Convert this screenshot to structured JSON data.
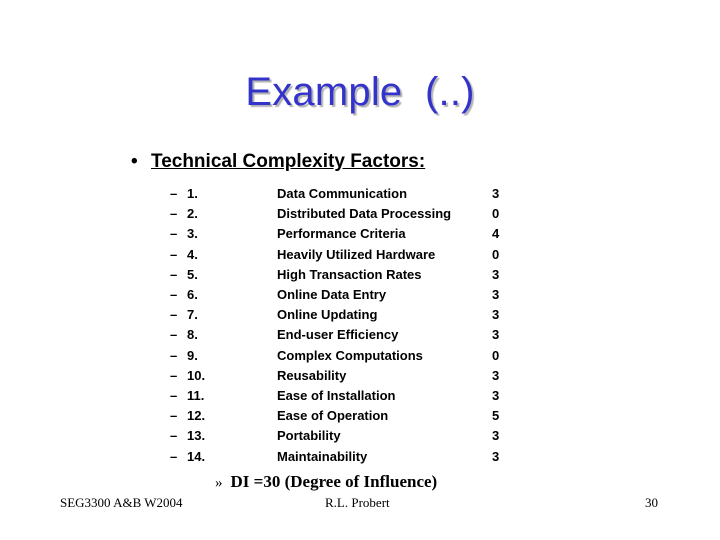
{
  "slide": {
    "title": "Example  (..)",
    "bullet": "•",
    "heading": "Technical Complexity Factors:",
    "sub_bullet": "–",
    "factors": [
      {
        "number": "1.",
        "name": "Data Communication",
        "value": "3"
      },
      {
        "number": "2.",
        "name": "Distributed Data Processing",
        "value": "0"
      },
      {
        "number": "3.",
        "name": "Performance Criteria",
        "value": "4"
      },
      {
        "number": "4.",
        "name": "Heavily Utilized Hardware",
        "value": "0"
      },
      {
        "number": "5.",
        "name": "High Transaction Rates",
        "value": "3"
      },
      {
        "number": "6.",
        "name": "Online Data Entry",
        "value": "3"
      },
      {
        "number": "7.",
        "name": "Online Updating",
        "value": "3"
      },
      {
        "number": "8.",
        "name": "End-user Efficiency",
        "value": "3"
      },
      {
        "number": "9.",
        "name": "Complex Computations",
        "value": "0"
      },
      {
        "number": "10.",
        "name": "Reusability",
        "value": "3"
      },
      {
        "number": "11.",
        "name": "Ease of Installation",
        "value": "3"
      },
      {
        "number": "12.",
        "name": "Ease of Operation",
        "value": "5"
      },
      {
        "number": "13.",
        "name": "Portability",
        "value": "3"
      },
      {
        "number": "14.",
        "name": "Maintainability",
        "value": "3"
      }
    ],
    "di_marker": "»",
    "di_text": "DI =30 (Degree of Influence)"
  },
  "footer": {
    "course": "SEG3300 A&B W2004",
    "author": "R.L. Probert",
    "page_number": "30"
  },
  "colors": {
    "title": "#3333cc",
    "text": "#000000",
    "background": "#ffffff"
  }
}
